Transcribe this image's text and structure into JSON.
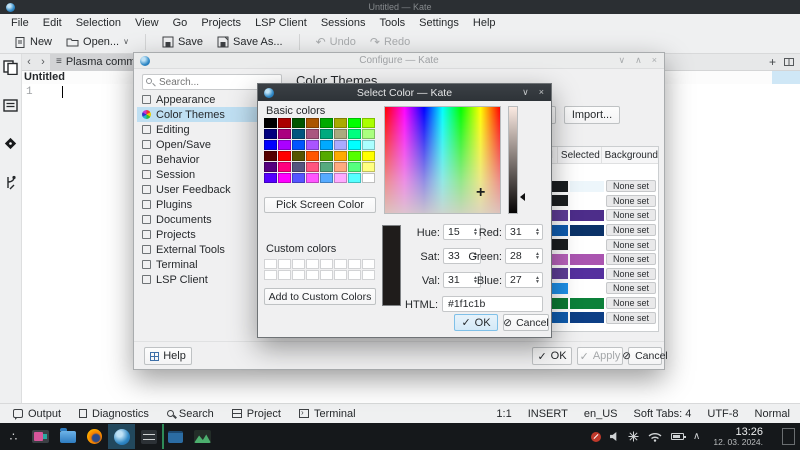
{
  "window": {
    "title": "Untitled — Kate"
  },
  "menubar": {
    "items": [
      "File",
      "Edit",
      "Selection",
      "View",
      "Go",
      "Projects",
      "LSP Client",
      "Sessions",
      "Tools",
      "Settings",
      "Help"
    ]
  },
  "toolbar": {
    "new": "New",
    "open": "Open...",
    "save": "Save",
    "save_as": "Save As...",
    "undo": "Undo",
    "redo": "Redo"
  },
  "tabbar": {
    "tab_label": "Plasma comment"
  },
  "editor": {
    "breadcrumb": "Untitled",
    "line_number": "1"
  },
  "panel_bar": {
    "items": [
      {
        "label": "Output",
        "icon": "bubble"
      },
      {
        "label": "Diagnostics",
        "icon": "page"
      },
      {
        "label": "Search",
        "icon": "search"
      },
      {
        "label": "Project",
        "icon": "grid"
      },
      {
        "label": "Terminal",
        "icon": "terminal"
      }
    ]
  },
  "statusbar": {
    "items": [
      "1:1",
      "INSERT",
      "en_US",
      "Soft Tabs: 4",
      "UTF-8",
      "Normal"
    ]
  },
  "configure_dialog": {
    "title": "Configure — Kate",
    "search_placeholder": "Search...",
    "page_title": "Color Themes",
    "sidebar_items": [
      {
        "label": "Appearance"
      },
      {
        "label": "Color Themes",
        "selected": true
      },
      {
        "label": "Editing"
      },
      {
        "label": "Open/Save"
      },
      {
        "label": "Behavior"
      },
      {
        "label": "Session"
      },
      {
        "label": "User Feedback"
      },
      {
        "label": "Plugins"
      },
      {
        "label": "Documents"
      },
      {
        "label": "Projects"
      },
      {
        "label": "External Tools"
      },
      {
        "label": "Terminal"
      },
      {
        "label": "LSP Client"
      }
    ],
    "partial_button_text": "...",
    "import_button": "Import...",
    "table": {
      "headers": [
        "al",
        "Selected",
        "Background"
      ],
      "rows": [
        {
          "normal": "#1b1e20",
          "selected": "#edf6fb",
          "background": "None set"
        },
        {
          "normal": "#1b1e20",
          "selected": "#ffffff",
          "background": "None set"
        },
        {
          "normal": "#5e3d96",
          "selected": "#4d2d8a",
          "background": "None set"
        },
        {
          "normal": "#0f5cae",
          "selected": "#0b3268",
          "background": "None set"
        },
        {
          "normal": "#1b1e20",
          "selected": "#ffffff",
          "background": "None set"
        },
        {
          "normal": "#b862bb",
          "selected": "#aa55b0",
          "background": "None set"
        },
        {
          "normal": "#5e3d96",
          "selected": "#55309e",
          "background": "None set"
        },
        {
          "normal": "#1e90e8",
          "selected": "#ffffff",
          "background": "None set"
        },
        {
          "normal": "#0b7a33",
          "selected": "#0c813a",
          "background": "None set"
        },
        {
          "normal": "#0f5cae",
          "selected": "#0d3f86",
          "background": "None set"
        }
      ]
    },
    "help_button": "Help",
    "ok_button": "OK",
    "apply_button": "Apply",
    "cancel_button": "Cancel"
  },
  "color_dialog": {
    "title": "Select Color — Kate",
    "basic_colors_label": "Basic colors",
    "basic_colors": [
      "#000000",
      "#aa0000",
      "#005500",
      "#aa5500",
      "#00aa00",
      "#aaaa00",
      "#00ff00",
      "#aaff00",
      "#00007f",
      "#aa007f",
      "#00557f",
      "#aa557f",
      "#00aa7f",
      "#aaaa7f",
      "#00ff7f",
      "#aaff7f",
      "#0000ff",
      "#aa00ff",
      "#0055ff",
      "#aa55ff",
      "#00aaff",
      "#aaaaff",
      "#00ffff",
      "#aaffff",
      "#550000",
      "#ff0000",
      "#555500",
      "#ff5500",
      "#55aa00",
      "#ffaa00",
      "#55ff00",
      "#ffff00",
      "#55007f",
      "#ff007f",
      "#55557f",
      "#ff557f",
      "#55aa7f",
      "#ffaa7f",
      "#55ff7f",
      "#ffff7f",
      "#5500ff",
      "#ff00ff",
      "#5555ff",
      "#ff55ff",
      "#55aaff",
      "#ffaaff",
      "#55ffff",
      "#ffffff"
    ],
    "pick_screen_button": "Pick Screen Color",
    "custom_colors_label": "Custom colors",
    "custom_colors": [
      "#ffffff",
      "#ffffff",
      "#ffffff",
      "#ffffff",
      "#ffffff",
      "#ffffff",
      "#ffffff",
      "#ffffff",
      "#ffffff",
      "#ffffff",
      "#ffffff",
      "#ffffff",
      "#ffffff",
      "#ffffff",
      "#ffffff",
      "#ffffff"
    ],
    "add_custom_button": "Add to Custom Colors",
    "preview_color": "#1f1c1b",
    "hue_label": "Hue:",
    "hue": "15",
    "sat_label": "Sat:",
    "sat": "33",
    "val_label": "Val:",
    "val": "31",
    "red_label": "Red:",
    "red": "31",
    "green_label": "Green:",
    "green": "28",
    "blue_label": "Blue:",
    "blue": "27",
    "html_label": "HTML:",
    "html": "#1f1c1b",
    "ok_button": "OK",
    "cancel_button": "Cancel"
  },
  "taskbar": {
    "apps": [
      "app-launcher",
      "media-player",
      "file-manager",
      "firefox",
      "kate",
      "system-settings",
      "development",
      "graphics"
    ],
    "tray": [
      "microphone-muted",
      "volume",
      "star",
      "wifi",
      "battery",
      "chevron-up"
    ],
    "clock_time": "13:26",
    "clock_date": "12. 03. 2024."
  }
}
